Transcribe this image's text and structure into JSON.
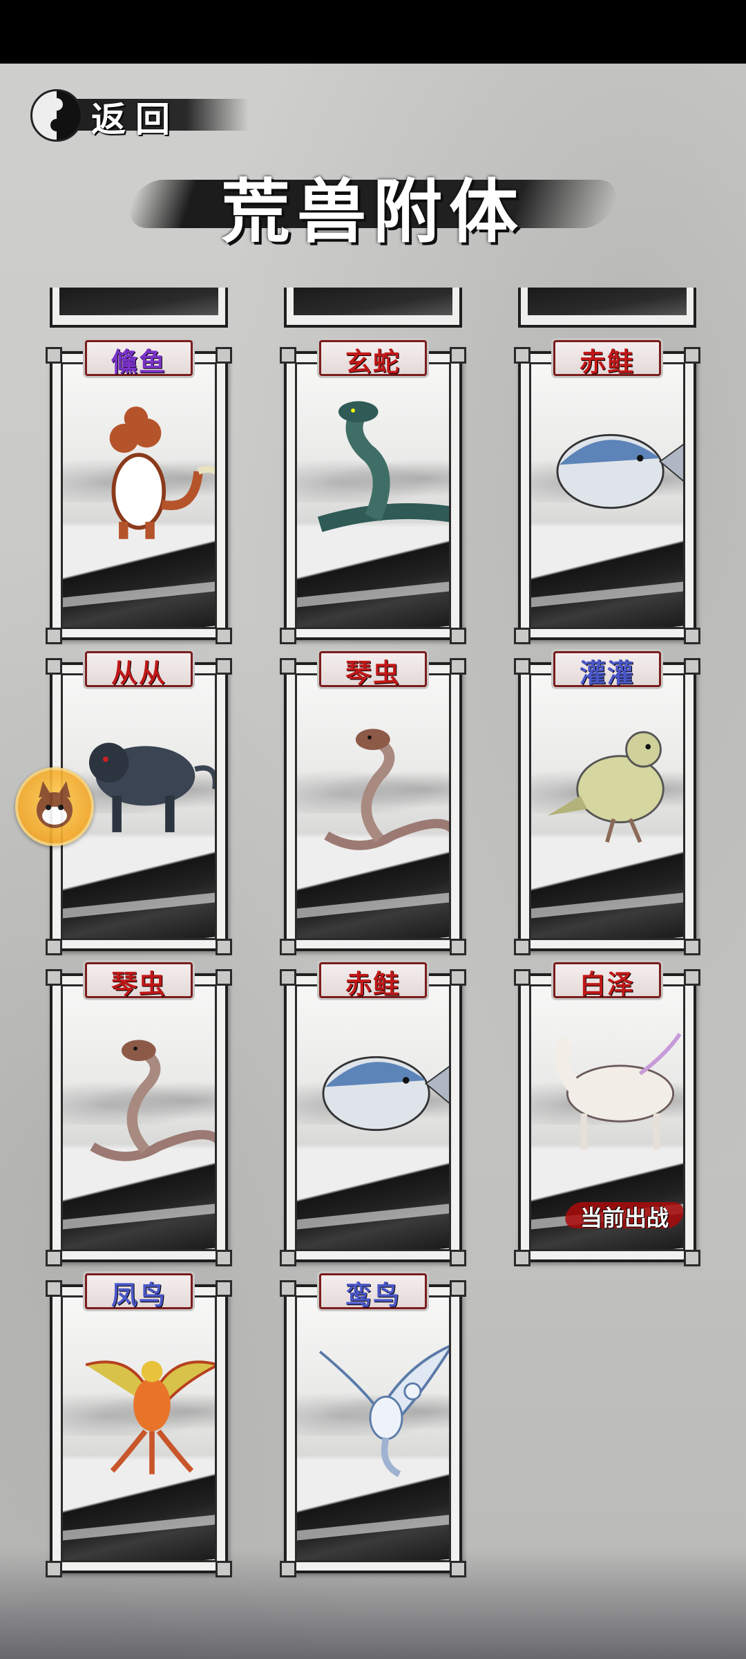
{
  "header": {
    "back_label": "返回",
    "title": "荒兽附体"
  },
  "cards": [
    {
      "name": "儵鱼",
      "name_color": "purple",
      "creature": "multi-headed-dragon-icon",
      "deployed": false
    },
    {
      "name": "玄蛇",
      "name_color": "red",
      "creature": "black-serpent-icon",
      "deployed": false
    },
    {
      "name": "赤鲑",
      "name_color": "red",
      "creature": "puffer-fish-icon",
      "deployed": false
    },
    {
      "name": "从从",
      "name_color": "red",
      "creature": "dark-bull-icon",
      "deployed": false
    },
    {
      "name": "琴虫",
      "name_color": "red",
      "creature": "horned-snake-icon",
      "deployed": false
    },
    {
      "name": "灌灌",
      "name_color": "blue",
      "creature": "dove-icon",
      "deployed": false
    },
    {
      "name": "琴虫",
      "name_color": "red",
      "creature": "horned-snake-icon",
      "deployed": false
    },
    {
      "name": "赤鲑",
      "name_color": "red",
      "creature": "puffer-fish-icon",
      "deployed": false
    },
    {
      "name": "白泽",
      "name_color": "red",
      "creature": "white-qilin-icon",
      "deployed": true
    },
    {
      "name": "凤鸟",
      "name_color": "blue",
      "creature": "phoenix-icon",
      "deployed": false
    },
    {
      "name": "鸾鸟",
      "name_color": "blue",
      "creature": "luan-bird-icon",
      "deployed": false
    }
  ],
  "deploy_label": "当前出战",
  "floating_button": {
    "icon": "fox-mascot-icon"
  }
}
